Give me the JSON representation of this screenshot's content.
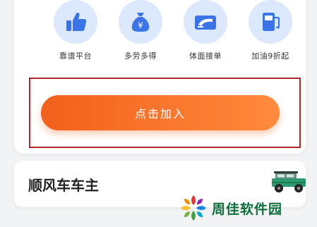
{
  "benefits": [
    {
      "label": "靠谱平台",
      "icon": "thumbs-up-icon"
    },
    {
      "label": "多劳多得",
      "icon": "money-bag-icon"
    },
    {
      "label": "体面接单",
      "icon": "car-window-icon"
    },
    {
      "label": "加油9折起",
      "icon": "fuel-pump-icon"
    }
  ],
  "join_button": {
    "label": "点击加入"
  },
  "section": {
    "title": "顺风车车主"
  },
  "watermark": {
    "text": "周佳软件园"
  },
  "colors": {
    "accent": "#f46a25",
    "icon_blue": "#3b74e6",
    "icon_bg": "#dce8fb",
    "highlight_border": "#b1252b",
    "watermark_green": "#0d6f3a"
  }
}
